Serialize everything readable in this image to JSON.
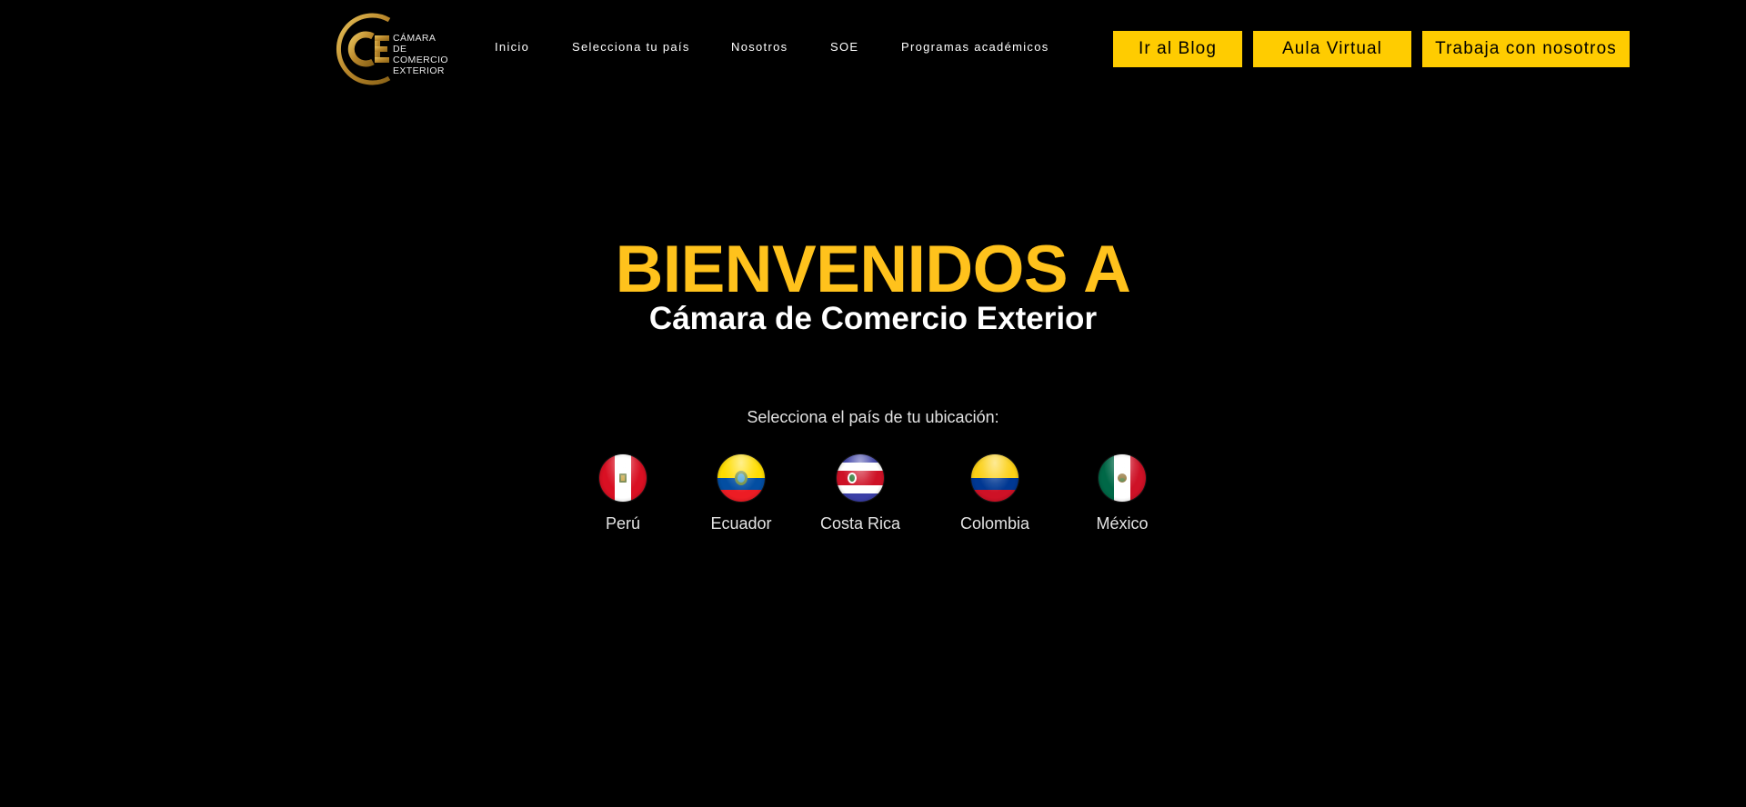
{
  "logo": {
    "mark": "CE",
    "lines": [
      "CÁMARA DE",
      "COMERCIO",
      "EXTERIOR"
    ],
    "gold": "#c9a13a"
  },
  "nav": {
    "items": [
      {
        "label": "Inicio"
      },
      {
        "label": "Selecciona tu país"
      },
      {
        "label": "Nosotros"
      },
      {
        "label": "SOE"
      },
      {
        "label": "Programas académicos"
      }
    ]
  },
  "cta": {
    "blog": "Ir al Blog",
    "aula": "Aula Virtual",
    "trabaja": "Trabaja con nosotros",
    "color": "#ffcc00"
  },
  "hero": {
    "title": "BIENVENIDOS A",
    "subtitle": "Cámara de Comercio Exterior",
    "title_color": "#ffc21c"
  },
  "country_select": {
    "prompt": "Selecciona el país de tu ubicación:",
    "countries": [
      {
        "name": "Perú",
        "icon": "peru-flag-icon"
      },
      {
        "name": "Ecuador",
        "icon": "ecuador-flag-icon"
      },
      {
        "name": "Costa Rica",
        "icon": "costa-rica-flag-icon"
      },
      {
        "name": "Colombia",
        "icon": "colombia-flag-icon"
      },
      {
        "name": "México",
        "icon": "mexico-flag-icon"
      }
    ]
  }
}
